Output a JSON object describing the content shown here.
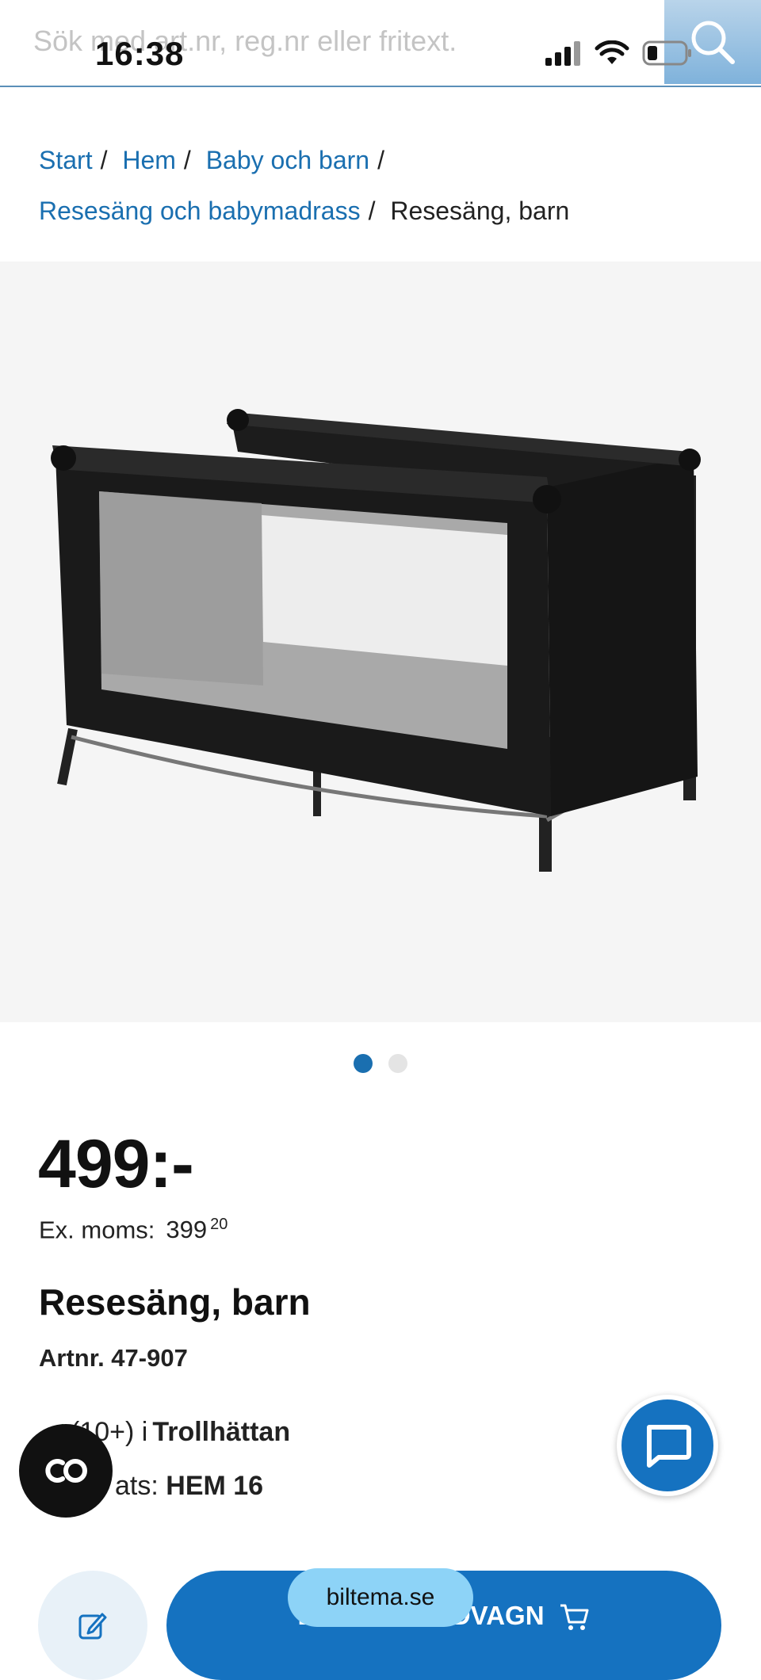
{
  "status": {
    "time": "16:38"
  },
  "search": {
    "placeholder": "Sök med art.nr, reg.nr eller fritext."
  },
  "breadcrumb": {
    "items": [
      "Start",
      "Hem",
      "Baby och barn",
      "Resesäng och babymadrass"
    ],
    "current": "Resesäng, barn",
    "separator": "/"
  },
  "gallery": {
    "image_count": 2,
    "active_index": 0
  },
  "product": {
    "price": "499:-",
    "exmoms_label": "Ex. moms:",
    "exmoms_value": "399",
    "exmoms_cents": "20",
    "title": "Resesäng, barn",
    "artnr": "Artnr. 47-907",
    "stock_count": "(10+) i",
    "stock_store": "Trollhättan",
    "place_label": "ats:",
    "place_value": "HEM 16"
  },
  "actions": {
    "cart_label": "LÄGG I KUNDVAGN"
  },
  "browser": {
    "url": "biltema.se"
  },
  "colors": {
    "accent": "#1572c0",
    "link": "#1a6fb0",
    "stock_green": "#2fa84f"
  },
  "icons": [
    "search-icon",
    "signal-icon",
    "wifi-icon",
    "battery-icon",
    "chat-icon",
    "co-icon",
    "edit-icon",
    "cart-icon",
    "check-icon"
  ]
}
